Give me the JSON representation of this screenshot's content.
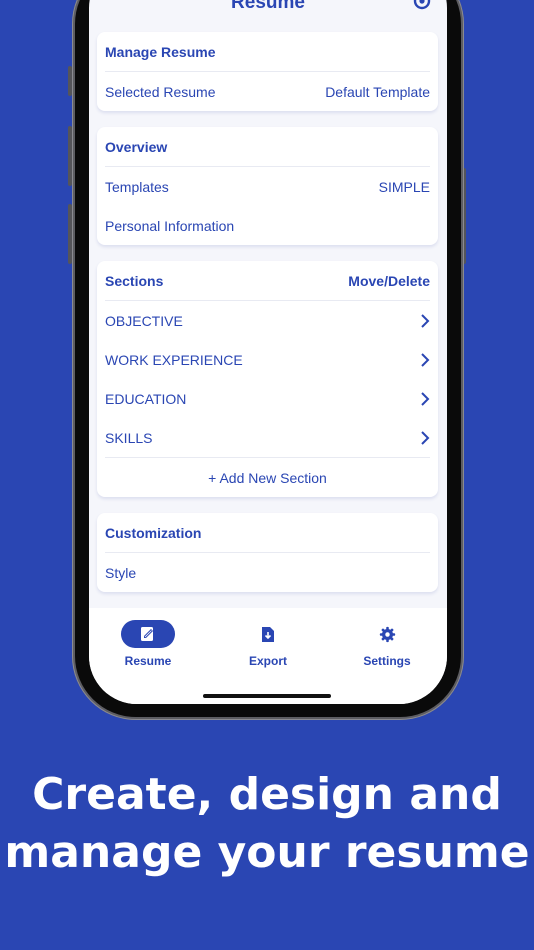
{
  "header": {
    "title": "Resume"
  },
  "manage": {
    "title": "Manage Resume",
    "selected_label": "Selected Resume",
    "selected_value": "Default Template"
  },
  "overview": {
    "title": "Overview",
    "templates_label": "Templates",
    "templates_value": "SIMPLE",
    "personal_label": "Personal Information"
  },
  "sections": {
    "title": "Sections",
    "action": "Move/Delete",
    "items": [
      {
        "label": "OBJECTIVE"
      },
      {
        "label": "WORK EXPERIENCE"
      },
      {
        "label": "EDUCATION"
      },
      {
        "label": "SKILLS"
      }
    ],
    "add_label": "+ Add New Section"
  },
  "customization": {
    "title": "Customization",
    "style_label": "Style"
  },
  "tabbar": {
    "tabs": [
      {
        "label": "Resume",
        "icon": "edit-document-icon",
        "active": true
      },
      {
        "label": "Export",
        "icon": "download-file-icon",
        "active": false
      },
      {
        "label": "Settings",
        "icon": "gear-icon",
        "active": false
      }
    ]
  },
  "tagline": {
    "line1": "Create, design and",
    "line2": "manage your resume"
  },
  "colors": {
    "accent": "#2a46b3",
    "background": "#2a46b3",
    "screen_bg": "#f5f6fb"
  }
}
